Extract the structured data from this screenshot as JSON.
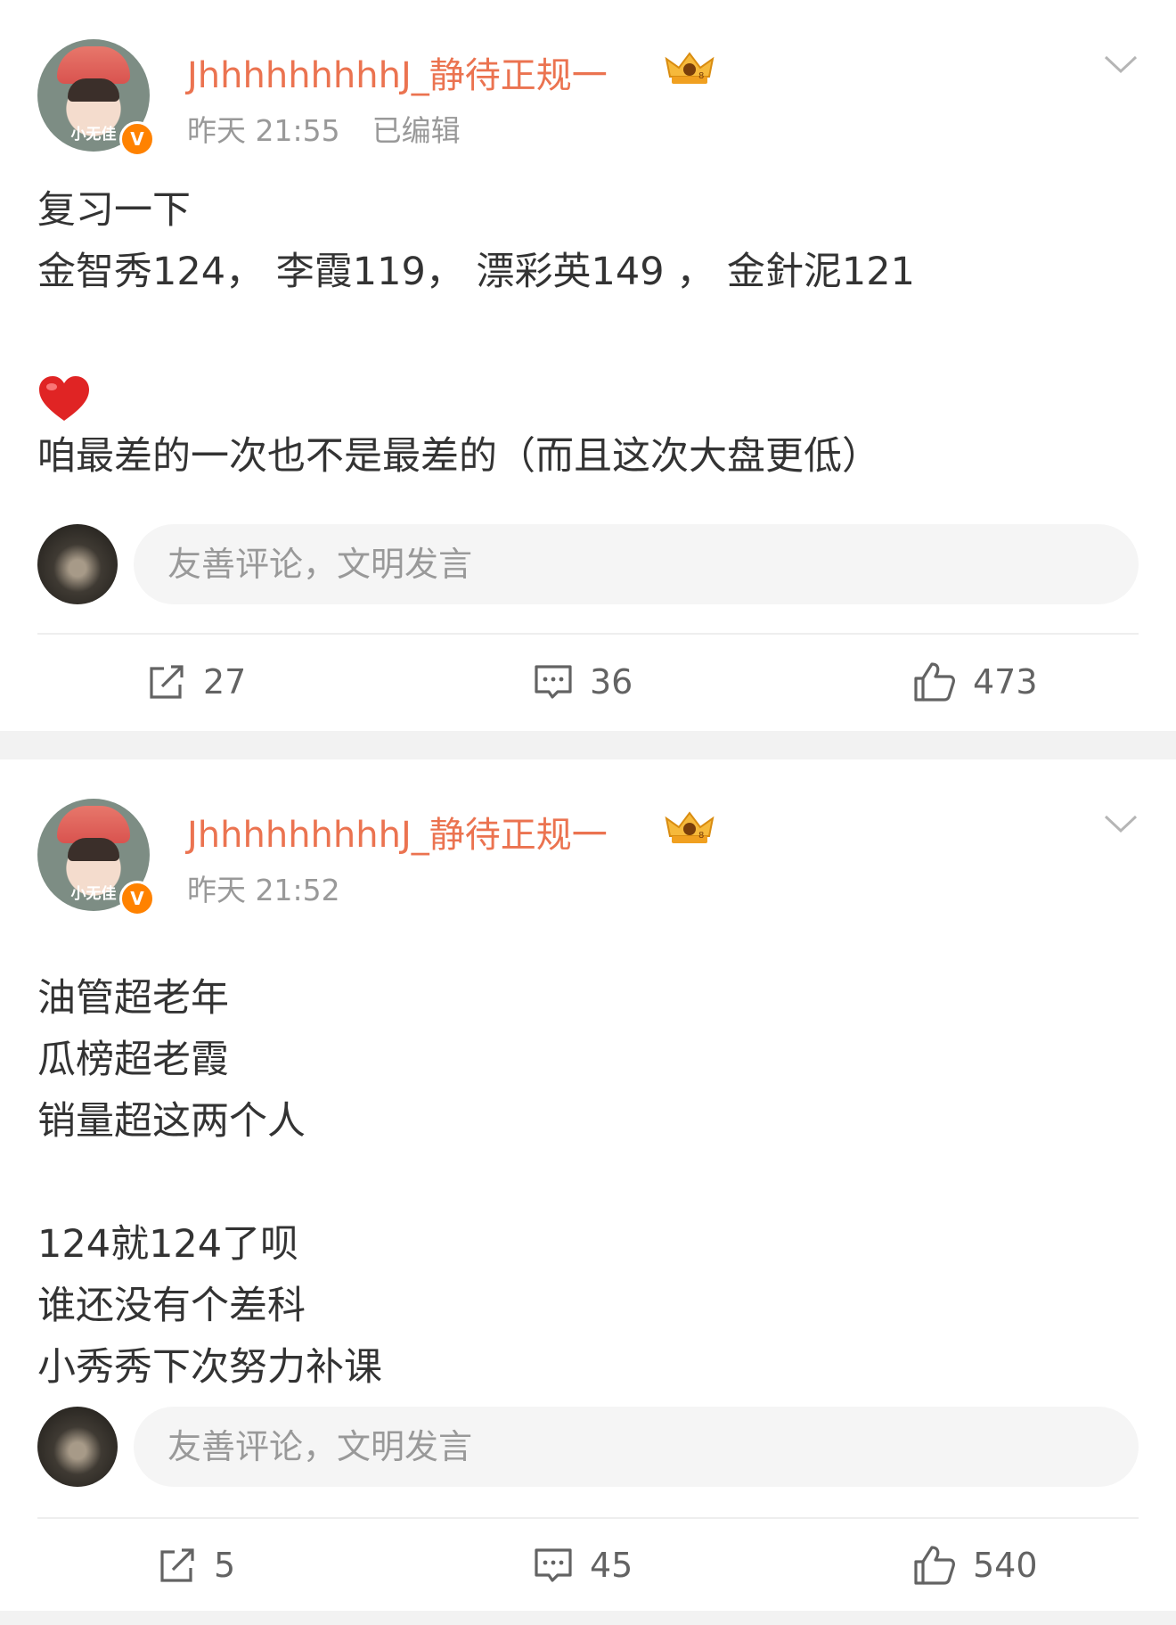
{
  "posts": [
    {
      "user": {
        "name": "JhhhhhhhhhJ_静待正规一",
        "avatar_caption": "小无佳",
        "verified_badge": "V"
      },
      "time": "昨天 21:55",
      "edited": "已编辑",
      "content_lines": [
        "复习一下",
        "金智秀124， 李霞119， 漂彩英149 ， 金針泥121",
        "",
        "",
        "咱最差的一次也不是最差的（而且这次大盘更低）"
      ],
      "emoji": "heart",
      "comment_placeholder": "友善评论，文明发言",
      "actions": {
        "reposts": "27",
        "comments": "36",
        "likes": "473"
      }
    },
    {
      "user": {
        "name": "JhhhhhhhhhJ_静待正规一",
        "avatar_caption": "小无佳",
        "verified_badge": "V"
      },
      "time": "昨天 21:52",
      "content_lines": [
        "油管超老年",
        "瓜榜超老霞",
        "销量超这两个人",
        "",
        "124就124了呗",
        "谁还没有个差科",
        "小秀秀下次努力补课"
      ],
      "comment_placeholder": "友善评论，文明发言",
      "actions": {
        "reposts": "5",
        "comments": "45",
        "likes": "540"
      }
    }
  ],
  "colors": {
    "username": "#eb7350",
    "meta": "#999999",
    "text": "#333333",
    "badge": "#ff8200",
    "separator": "#f2f2f2"
  },
  "icons": [
    "chevron-down-icon",
    "vip-crown-icon",
    "verified-icon",
    "heart-emoji-icon",
    "repost-icon",
    "comment-icon",
    "like-icon"
  ]
}
